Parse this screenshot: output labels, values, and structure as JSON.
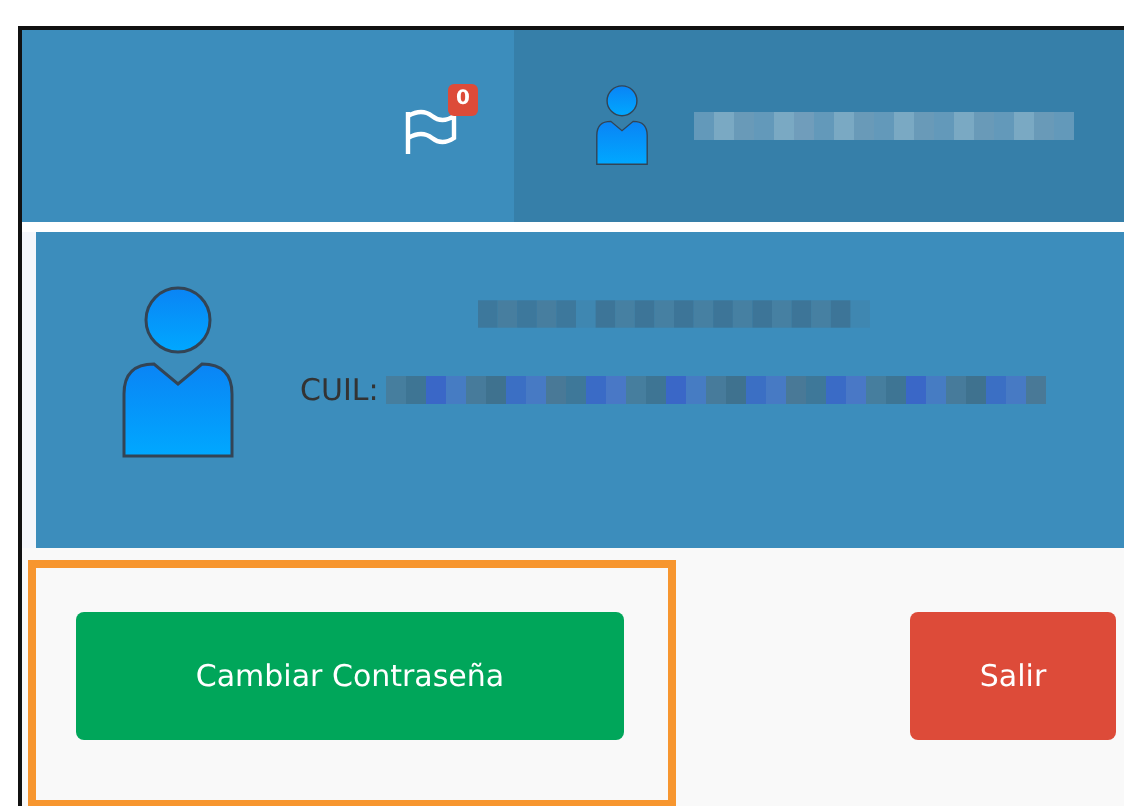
{
  "navbar": {
    "notifications": {
      "count": "0"
    }
  },
  "user_panel": {
    "cuil_label": "CUIL:"
  },
  "footer": {
    "highlighted": true,
    "buttons": [
      {
        "label": "Cambiar Contraseña",
        "kind": "primary"
      },
      {
        "label": "Salir",
        "kind": "danger"
      }
    ]
  }
}
